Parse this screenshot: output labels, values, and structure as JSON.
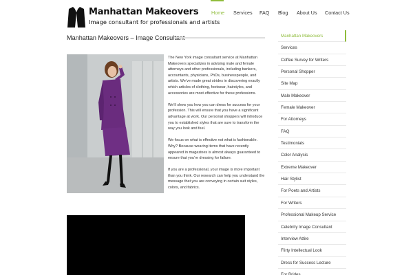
{
  "header": {
    "title": "Manhattan Makeovers",
    "tagline": "Image consultant for professionals and artists",
    "logo_icon": "jacket-icon"
  },
  "nav": {
    "items": [
      {
        "label": "Home",
        "active": true
      },
      {
        "label": "Services"
      },
      {
        "label": "FAQ"
      },
      {
        "label": "Blog"
      },
      {
        "label": "About Us"
      },
      {
        "label": "Contact Us"
      }
    ]
  },
  "page": {
    "title": "Manhattan Makeovers – Image Consultant"
  },
  "content": {
    "paragraphs": [
      "The New York image consultant service at Manhattan Makeovers specializes in advising male and female attorneys and other professionals, including bankers, accountants, physicians, PhDs, businesspeople, and artists. We’ve made great strides in discovering exactly which articles of clothing, footwear, hairstyles, and accessories are most effective for these professions.",
      "We’ll show you how you can dress for success for your profession. This will ensure that you have a significant advantage at work. Our personal shoppers will introduce you to established styles that are sure to transform the way you look and feel.",
      "We focus on what is effective not what is fashionable. Why? Because wearing items that have recently appeared in magazines is almost always guaranteed to ensure that you’re dressing for failure.",
      "If you are a professional, your image is more important than you think. Our research can help you understand the message that you are conveying in certain suit styles, colors, and fabrics."
    ]
  },
  "sidebar": {
    "items": [
      {
        "label": "Manhattan Makeovers",
        "active": true
      },
      {
        "label": "Services"
      },
      {
        "label": "Coffee Survey for Writers"
      },
      {
        "label": "Personal Shopper"
      },
      {
        "label": "Site Map"
      },
      {
        "label": "Male Makeover"
      },
      {
        "label": "Female Makeover"
      },
      {
        "label": "For Attorneys"
      },
      {
        "label": "FAQ"
      },
      {
        "label": "Testimonials"
      },
      {
        "label": "Color Analysis"
      },
      {
        "label": "Extreme Makeover"
      },
      {
        "label": "Hair Stylist"
      },
      {
        "label": "For Poets and Artists"
      },
      {
        "label": "For Writers"
      },
      {
        "label": "Professional Makeup Service"
      },
      {
        "label": "Celebrity Image Consultant"
      },
      {
        "label": "Interview Attire"
      },
      {
        "label": "Flirty Intellectual Look"
      },
      {
        "label": "Dress for Success Lecture"
      },
      {
        "label": "For Brides"
      }
    ]
  },
  "colors": {
    "accent": "#8fbc3b",
    "suit": "#6a2c7e"
  }
}
